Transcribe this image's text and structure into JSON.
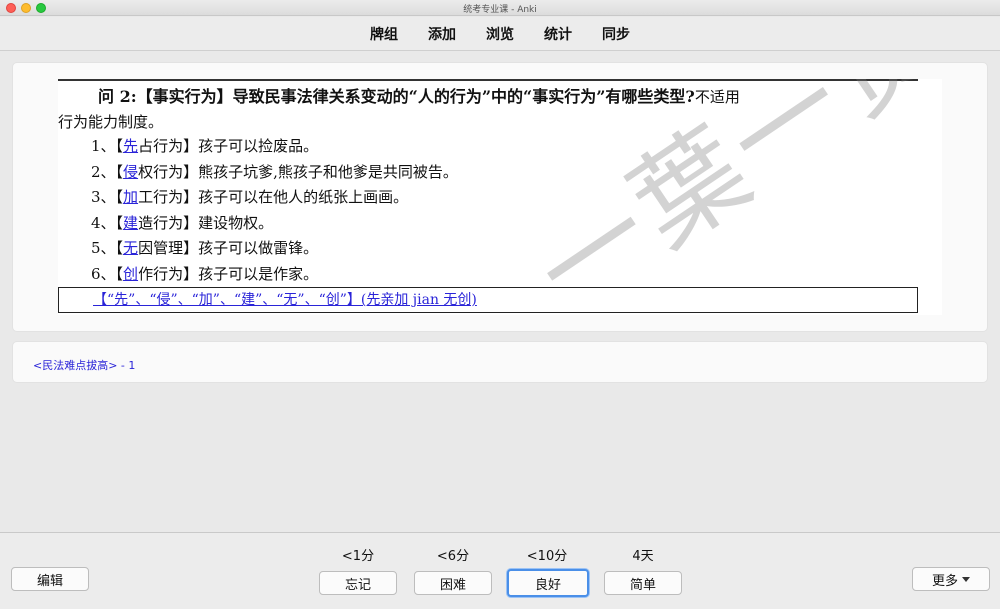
{
  "window": {
    "title": "统考专业课 - Anki"
  },
  "nav": {
    "decks": "牌组",
    "add": "添加",
    "browse": "浏览",
    "stats": "统计",
    "sync": "同步"
  },
  "card": {
    "question_bold": "问 2:【事实行为】导致民事法律关系变动的“人的行为”中的“事实行为”有哪些类型?",
    "question_note": "不适用",
    "question_cont": "行为能力制度。",
    "items": [
      {
        "prefix": "1、【",
        "hl": "先",
        "rest": "占行为】孩子可以捡废品。"
      },
      {
        "prefix": "2、【",
        "hl": "侵",
        "rest": "权行为】熊孩子坑爹,熊孩子和他爹是共同被告。"
      },
      {
        "prefix": "3、【",
        "hl": "加",
        "rest": "工行为】孩子可以在他人的纸张上画画。"
      },
      {
        "prefix": "4、【",
        "hl": "建",
        "rest": "造行为】建设物权。"
      },
      {
        "prefix": "5、【",
        "hl": "无",
        "rest": "因管理】孩子可以做雷锋。"
      },
      {
        "prefix": "6、【",
        "hl": "创",
        "rest": "作行为】孩子可以是作家。"
      }
    ],
    "summary": "【“先”、“侵”、“加”、“建”、“无”、“创”】(先亲加 jian 无创)",
    "watermark": "一葉一贤"
  },
  "deck_info": {
    "text": "<民法难点拔高> - 1"
  },
  "bottom": {
    "edit": "编辑",
    "more": "更多",
    "answers": [
      {
        "interval": "<1分",
        "label": "忘记"
      },
      {
        "interval": "<6分",
        "label": "困难"
      },
      {
        "interval": "<10分",
        "label": "良好"
      },
      {
        "interval": "4天",
        "label": "简单"
      }
    ]
  }
}
